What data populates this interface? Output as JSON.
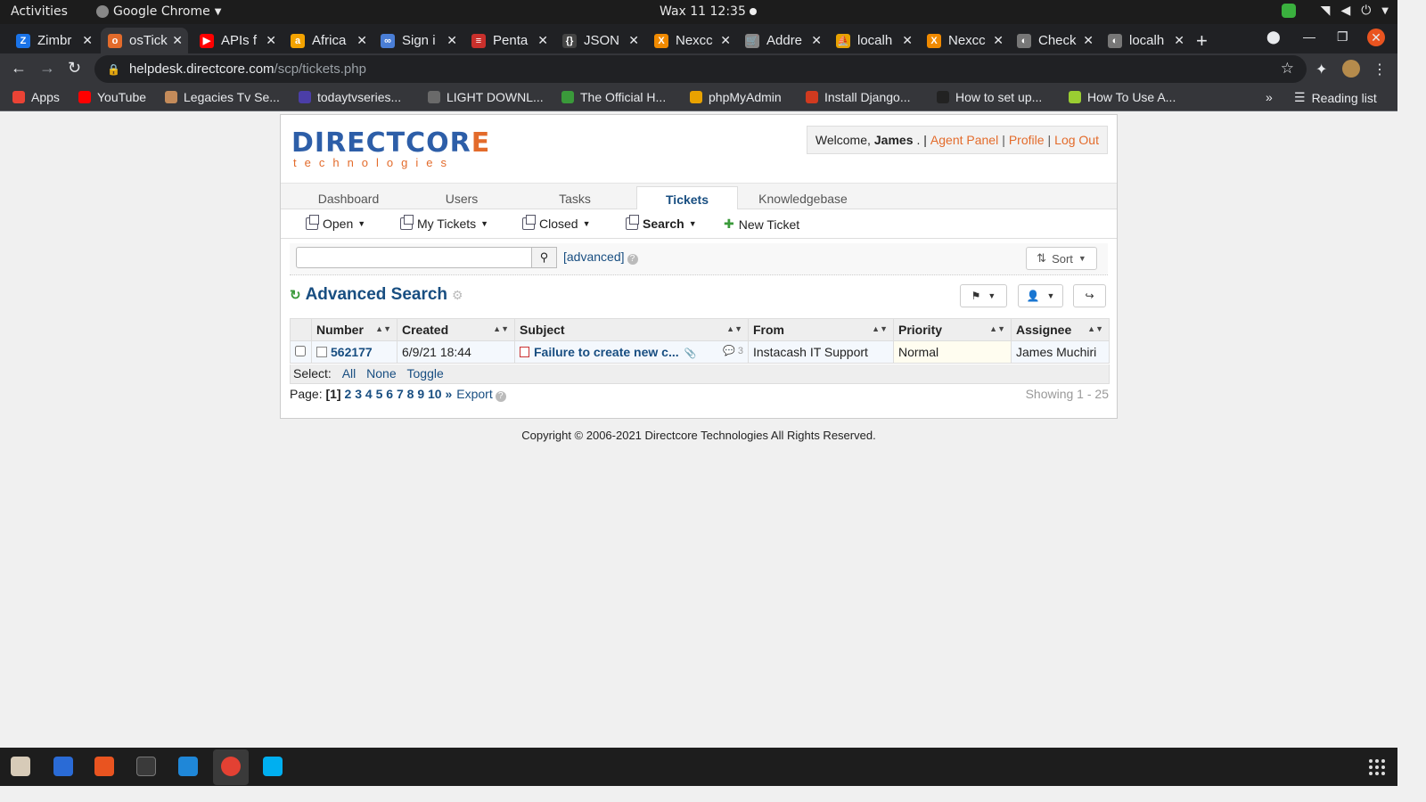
{
  "system": {
    "activities": "Activities",
    "app_name": "Google Chrome",
    "clock": "Wax 11  12:35"
  },
  "browser": {
    "tabs": [
      {
        "label": "Zimbr",
        "color": "#1a73e8",
        "letter": "Z"
      },
      {
        "label": "osTick",
        "color": "#e36b2b",
        "letter": "o",
        "active": true
      },
      {
        "label": "APIs f",
        "color": "#ff0000",
        "letter": "▶"
      },
      {
        "label": "Africa",
        "color": "#f4a300",
        "letter": "a"
      },
      {
        "label": "Sign i",
        "color": "#4a7ed6",
        "letter": "∞"
      },
      {
        "label": "Penta",
        "color": "#c9302c",
        "letter": "≡"
      },
      {
        "label": "JSON",
        "color": "#444444",
        "letter": "{}"
      },
      {
        "label": "Nexcc",
        "color": "#f08a00",
        "letter": "X"
      },
      {
        "label": "Addre",
        "color": "#888888",
        "letter": "🛒"
      },
      {
        "label": "localh",
        "color": "#e8a200",
        "letter": "⛵"
      },
      {
        "label": "Nexcc",
        "color": "#f08a00",
        "letter": "X"
      },
      {
        "label": "Check",
        "color": "#777777",
        "letter": "◐"
      },
      {
        "label": "localh",
        "color": "#777777",
        "letter": "◐"
      }
    ],
    "url_host": "helpdesk.directcore.com",
    "url_path": "/scp/tickets.php",
    "bookmarks": [
      {
        "label": "Apps",
        "color": "#ea4335"
      },
      {
        "label": "YouTube",
        "color": "#ff0000"
      },
      {
        "label": "Legacies Tv Se...",
        "color": "#c48b5a"
      },
      {
        "label": "todaytvseries...",
        "color": "#4b3ea8"
      },
      {
        "label": "LIGHT DOWNL...",
        "color": "#6a6a6a"
      },
      {
        "label": "The Official H...",
        "color": "#3a9a3a"
      },
      {
        "label": "phpMyAdmin",
        "color": "#e8a200"
      },
      {
        "label": "Install Django...",
        "color": "#d13a1f"
      },
      {
        "label": "How to set up...",
        "color": "#222222"
      },
      {
        "label": "How To Use A...",
        "color": "#9acd32"
      }
    ],
    "reading_list": "Reading list",
    "more": "»"
  },
  "header": {
    "logo_main": "DIRECTCOR",
    "logo_accent": "E",
    "logo_sub": "technologies",
    "welcome_prefix": "Welcome,",
    "welcome_name": "James",
    "welcome_suffix": ". |",
    "agent_panel": "Agent Panel",
    "profile": "Profile",
    "logout": "Log Out",
    "pipe": "|"
  },
  "nav": {
    "dashboard": "Dashboard",
    "users": "Users",
    "tasks": "Tasks",
    "tickets": "Tickets",
    "knowledgebase": "Knowledgebase"
  },
  "subnav": {
    "open": "Open",
    "my_tickets": "My Tickets",
    "closed": "Closed",
    "search": "Search",
    "new_ticket": "New Ticket"
  },
  "search": {
    "value": "",
    "advanced": "[advanced]",
    "sort": "Sort"
  },
  "main": {
    "title": "Advanced Search"
  },
  "table": {
    "headers": [
      "Number",
      "Created",
      "Subject",
      "From",
      "Priority",
      "Assignee"
    ],
    "rows": [
      {
        "number": "562177",
        "created": "6/9/21 18:44",
        "subject": "Failure to create new c...",
        "thread_count": "3",
        "from": "Instacash IT Support",
        "priority": "Normal",
        "assignee": "James Muchiri"
      }
    ]
  },
  "select": {
    "label": "Select:",
    "all": "All",
    "none": "None",
    "toggle": "Toggle"
  },
  "pagination": {
    "label": "Page:",
    "current": "[1]",
    "pages": [
      "2",
      "3",
      "4",
      "5",
      "6",
      "7",
      "8",
      "9",
      "10"
    ],
    "next": "»",
    "export": "Export",
    "showing": "Showing 1 - 25"
  },
  "footer": {
    "copyright": "Copyright © 2006-2021 Directcore Technologies All Rights Reserved."
  },
  "colors": {
    "link": "#184e81",
    "accent": "#e36b2b",
    "logo_blue": "#2d5ea8"
  }
}
